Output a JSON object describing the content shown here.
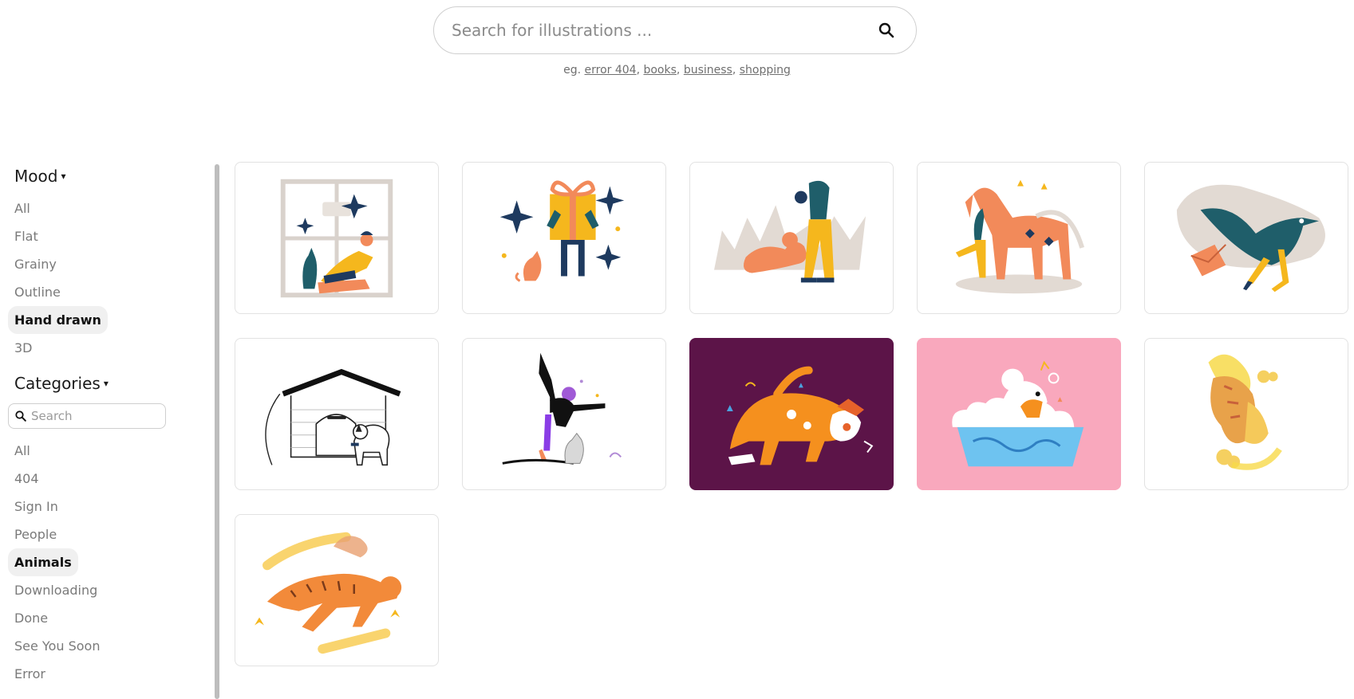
{
  "search": {
    "placeholder": "Search for illustrations ..."
  },
  "examples": {
    "prefix": "eg.",
    "links": [
      "error 404",
      "books",
      "business",
      "shopping"
    ]
  },
  "sidebar": {
    "mood": {
      "title": "Mood",
      "items": [
        "All",
        "Flat",
        "Grainy",
        "Outline",
        "Hand drawn",
        "3D"
      ],
      "active": "Hand drawn"
    },
    "categories": {
      "title": "Categories",
      "search_placeholder": "Search",
      "items": [
        "All",
        "404",
        "Sign In",
        "People",
        "Animals",
        "Downloading",
        "Done",
        "See You Soon",
        "Error"
      ],
      "active": "Animals"
    }
  },
  "grid": {
    "cards": [
      {
        "subject": "person-with-cat-at-window",
        "background": "#ffffff"
      },
      {
        "subject": "person-with-gift-and-dog",
        "background": "#ffffff"
      },
      {
        "subject": "person-with-dog-lying",
        "background": "#ffffff"
      },
      {
        "subject": "person-with-horse",
        "background": "#ffffff"
      },
      {
        "subject": "bird-with-letter",
        "background": "#ffffff"
      },
      {
        "subject": "doghouse-outline",
        "background": "#ffffff"
      },
      {
        "subject": "yoga-with-cat",
        "background": "#ffffff"
      },
      {
        "subject": "orange-dog",
        "background": "#5c1448"
      },
      {
        "subject": "dog-in-bath",
        "background": "#f9a8bd"
      },
      {
        "subject": "tiger-cats-yellow",
        "background": "#ffffff"
      },
      {
        "subject": "tiger-running",
        "background": "#ffffff"
      }
    ]
  },
  "colors": {
    "active_bg": "#f0f0f0",
    "orange": "#f28a5a",
    "teal": "#1f5e6a",
    "yellow": "#f5b71d",
    "navy": "#1e3a5f"
  }
}
